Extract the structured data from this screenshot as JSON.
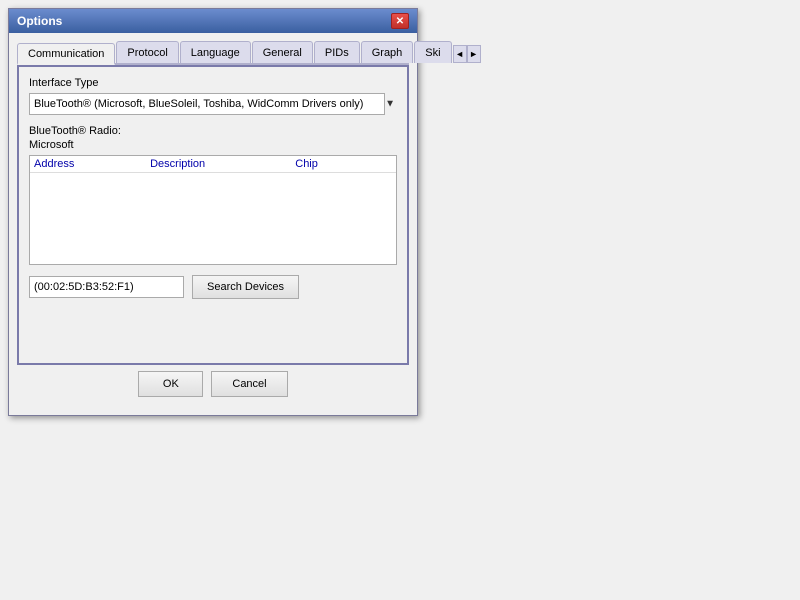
{
  "window": {
    "title": "Options",
    "close_label": "✕"
  },
  "tabs": [
    {
      "id": "communication",
      "label": "Communication",
      "active": true
    },
    {
      "id": "protocol",
      "label": "Protocol",
      "active": false
    },
    {
      "id": "language",
      "label": "Language",
      "active": false
    },
    {
      "id": "general",
      "label": "General",
      "active": false
    },
    {
      "id": "pids",
      "label": "PIDs",
      "active": false
    },
    {
      "id": "graph",
      "label": "Graph",
      "active": false
    },
    {
      "id": "ski",
      "label": "Ski",
      "active": false
    }
  ],
  "tab_arrows": {
    "left": "◄",
    "right": "►"
  },
  "form": {
    "interface_type_label": "Interface Type",
    "interface_type_value": "BlueTooth® (Microsoft, BlueSoleil, Toshiba, WidComm Drivers only)",
    "bluetooth_radio_label": "BlueTooth® Radio:",
    "microsoft_label": "Microsoft",
    "table": {
      "columns": [
        "Address",
        "Description",
        "Chip"
      ]
    },
    "address_value": "(00:02:5D:B3:52:F1)",
    "search_devices_label": "Search Devices"
  },
  "footer": {
    "ok_label": "OK",
    "cancel_label": "Cancel"
  }
}
